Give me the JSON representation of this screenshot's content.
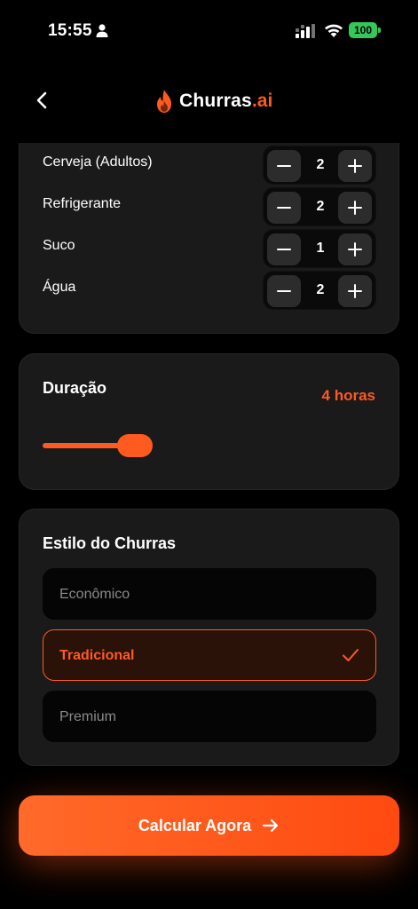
{
  "status_bar": {
    "time": "15:55",
    "battery": "100",
    "icons": [
      "person-icon",
      "signal-icon",
      "wifi-icon",
      "battery-icon"
    ]
  },
  "header": {
    "back_icon": "chevron-left-icon",
    "logo_icon": "flame-icon",
    "brand_name": "Churras",
    "brand_suffix": ".ai"
  },
  "drinks": {
    "items": [
      {
        "label": "Cerveja (Adultos)",
        "value": "2"
      },
      {
        "label": "Refrigerante",
        "value": "2"
      },
      {
        "label": "Suco",
        "value": "1"
      },
      {
        "label": "Água",
        "value": "2"
      }
    ]
  },
  "duration": {
    "title": "Duração",
    "value_label": "4 horas",
    "slider_fraction": 0.4
  },
  "style": {
    "title": "Estilo do Churras",
    "options": [
      {
        "label": "Econômico",
        "selected": false
      },
      {
        "label": "Tradicional",
        "selected": true
      },
      {
        "label": "Premium",
        "selected": false
      }
    ]
  },
  "cta": {
    "label": "Calcular Agora",
    "icon": "arrow-right-icon"
  },
  "colors": {
    "accent": "#ff5a1f",
    "background": "#000000",
    "card": "#1a1a1a",
    "battery": "#34c759"
  }
}
